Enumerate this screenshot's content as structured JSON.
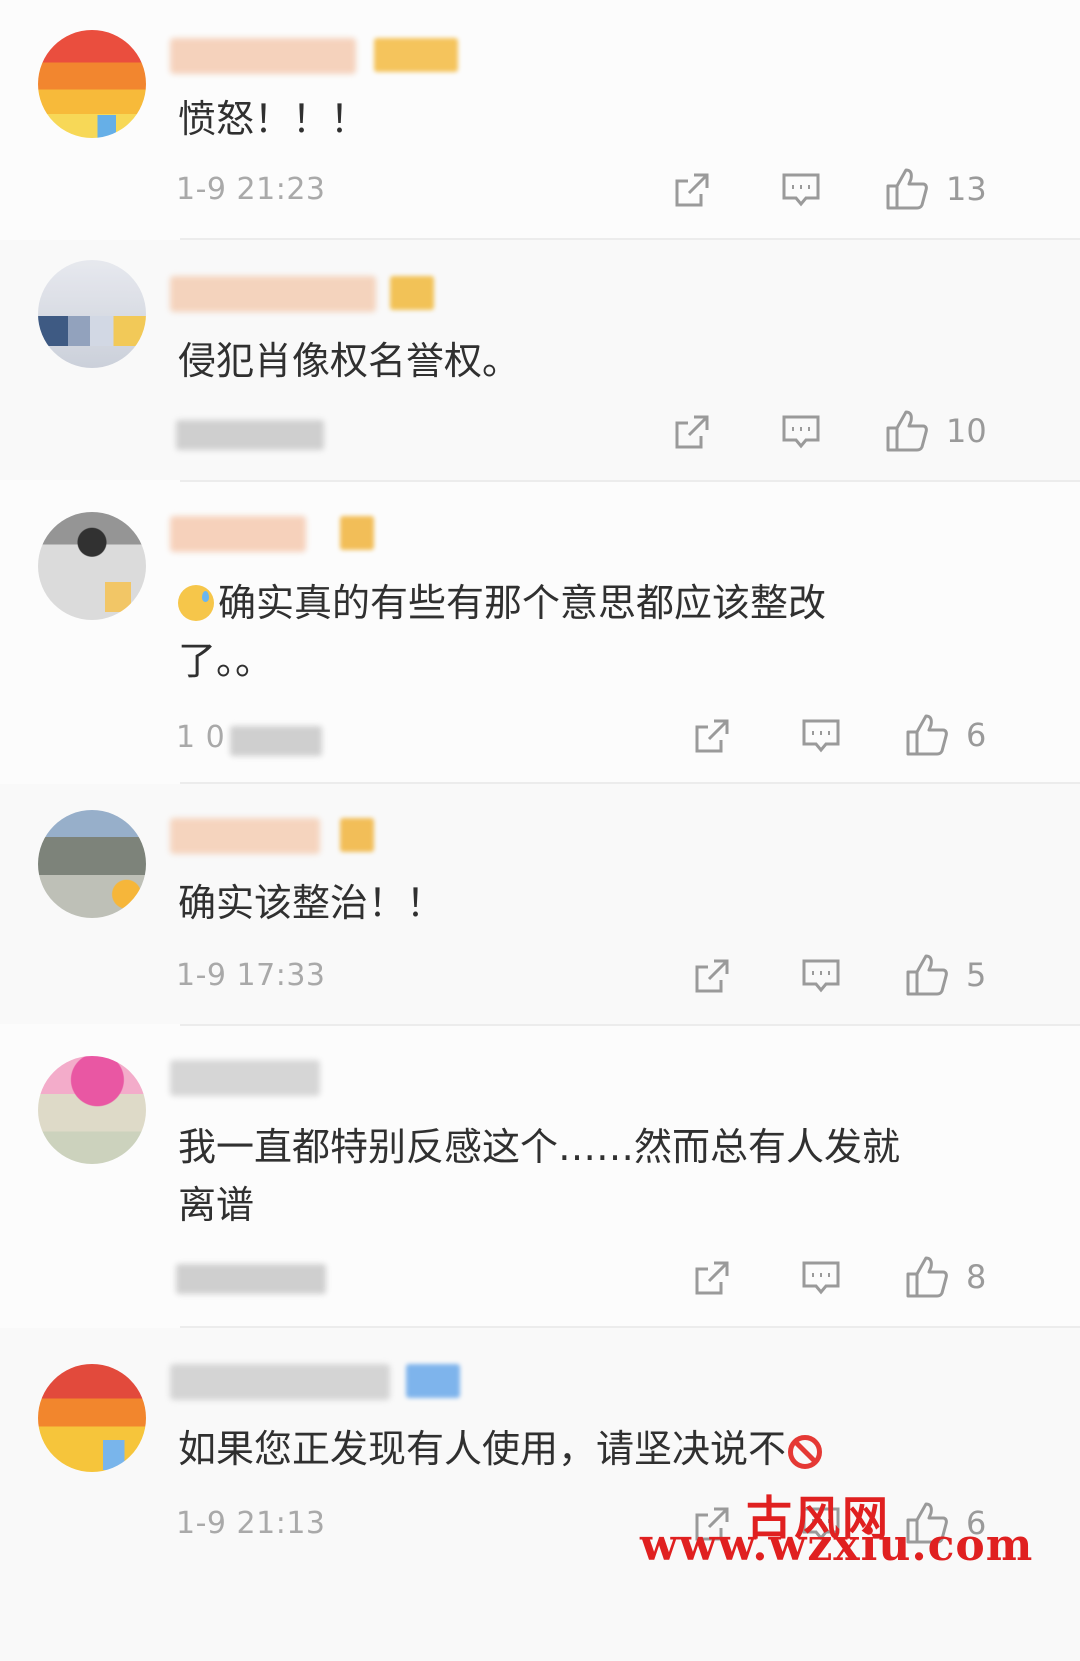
{
  "comments": [
    {
      "text": "愤怒！！！",
      "time": "1-9 21:23",
      "likes": "13"
    },
    {
      "text": "侵犯肖像权名誉权。",
      "time": "",
      "likes": "10"
    },
    {
      "text": "确实真的有些有那个意思都应该整改\n了。。",
      "time": "1 0",
      "likes": "6"
    },
    {
      "text": "确实该整治！！",
      "time": "1-9 17:33",
      "likes": "5"
    },
    {
      "text": "我一直都特别反感这个……然而总有人发就\n离谱",
      "time": "",
      "likes": "8"
    },
    {
      "text": "如果您正发现有人使用，请坚决说不",
      "time": "1-9 21:13",
      "likes": "6"
    }
  ],
  "icons": {
    "share": "share-icon",
    "comment": "comment-icon",
    "like": "thumbs-up-icon",
    "sad_emoji": "sad-sweat-emoji-icon",
    "no_entry": "prohibited-icon"
  },
  "watermark": {
    "cn": "古风网",
    "en": "www.wzxiu.com"
  },
  "colors": {
    "text": "#303030",
    "meta": "#a9a9a9",
    "watermark": "#e02020"
  }
}
